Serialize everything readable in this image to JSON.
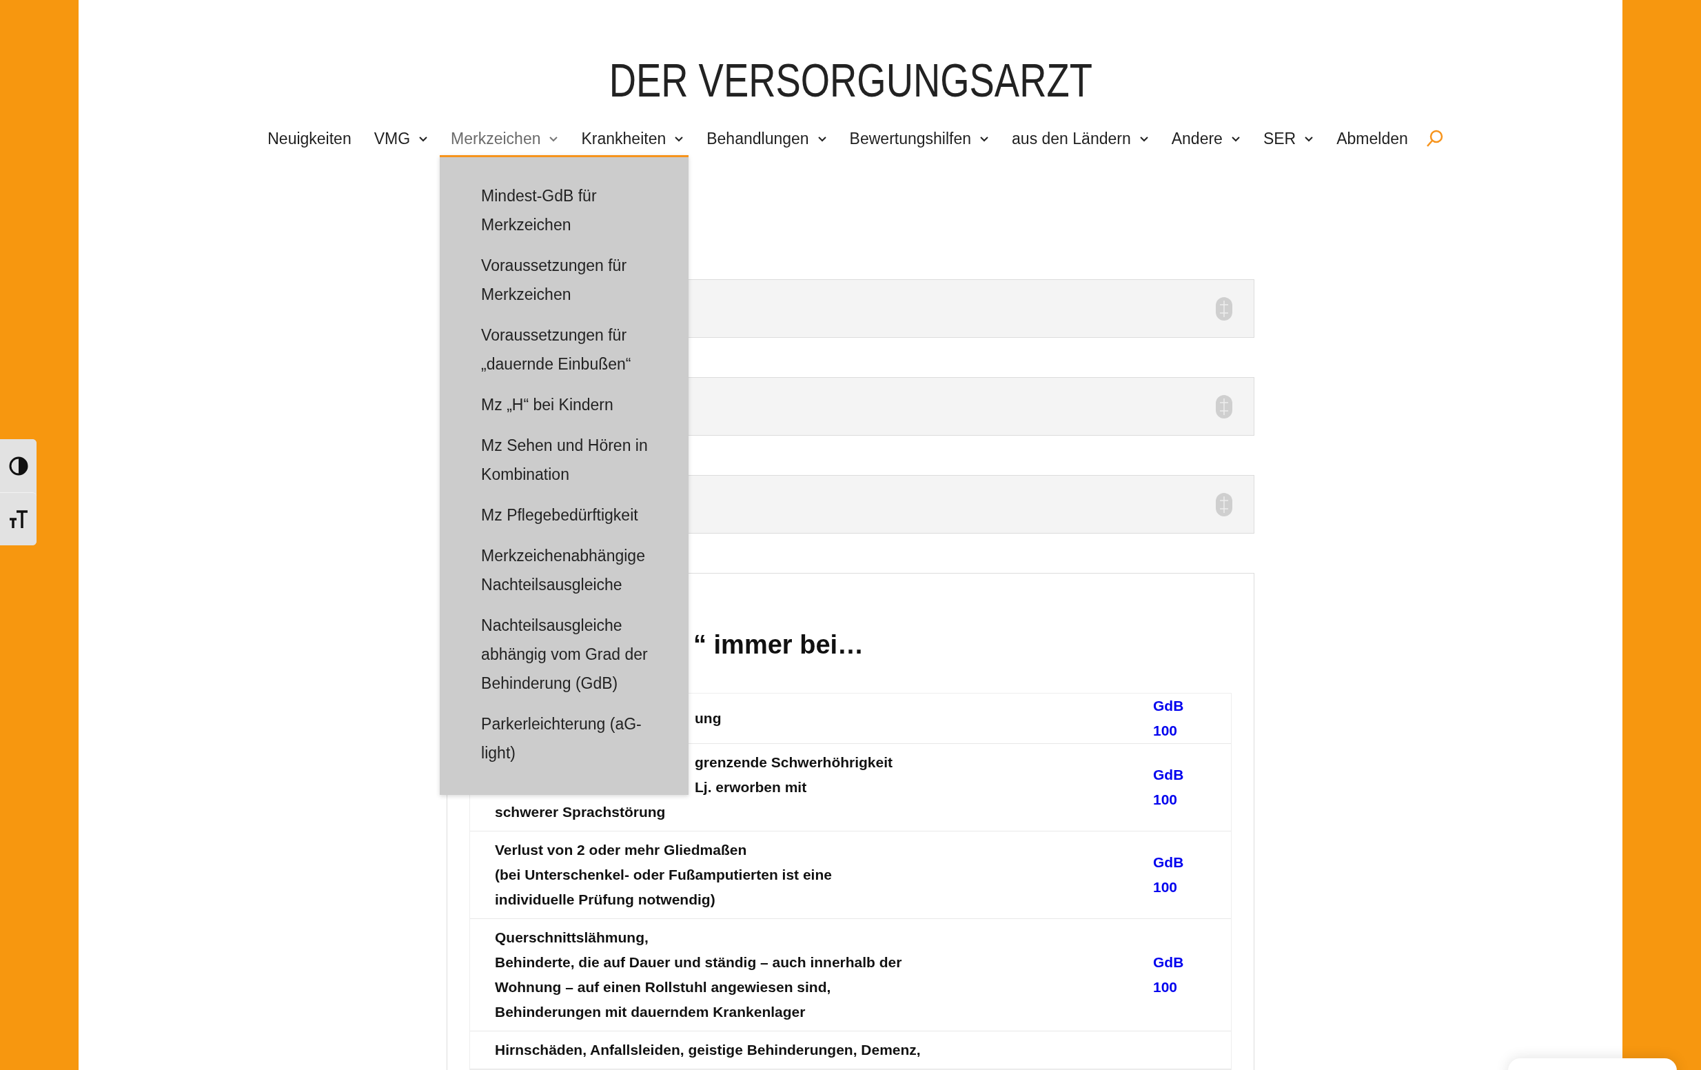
{
  "site": {
    "logo": "DER VERSORGUNGSARZT"
  },
  "nav": [
    {
      "label": "Neuigkeiten",
      "has_menu": false,
      "selected": false
    },
    {
      "label": "VMG",
      "has_menu": true,
      "selected": false
    },
    {
      "label": "Merkzeichen",
      "has_menu": true,
      "selected": true
    },
    {
      "label": "Krankheiten",
      "has_menu": true,
      "selected": false
    },
    {
      "label": "Behandlungen",
      "has_menu": true,
      "selected": false
    },
    {
      "label": "Bewertungshilfen",
      "has_menu": true,
      "selected": false
    },
    {
      "label": "aus den Ländern",
      "has_menu": true,
      "selected": false
    },
    {
      "label": "Andere",
      "has_menu": true,
      "selected": false
    },
    {
      "label": "SER",
      "has_menu": true,
      "selected": false
    },
    {
      "label": "Abmelden",
      "has_menu": false,
      "selected": false
    }
  ],
  "dropdown": {
    "items": [
      "Mindest-GdB für Merkzeichen",
      "Voraussetzungen für Merkzeichen",
      "Voraussetzungen für „dauernde Einbußen“",
      "Mz „H“ bei Kindern",
      "Mz Sehen und Hören in Kombination",
      "Mz Pflegebedürftigkeit",
      "Merkzeichenabhängige Nachteilsausgleiche",
      "Nachteilsausgleiche abhängig vom Grad der Behinderung (GdB)",
      "Parkerleichterung (aG-light)"
    ]
  },
  "accordions": [
    {
      "expanded": false
    },
    {
      "expanded": false
    },
    {
      "expanded": false
    }
  ],
  "section": {
    "heading": {
      "text": "“ immer bei…",
      "covered": true
    },
    "rows": [
      {
        "lines": [
          {
            "text": "ung",
            "covered": true
          }
        ],
        "gdb": "GdB 100"
      },
      {
        "lines": [
          {
            "text": "grenzende Schwerhöhrigkeit",
            "covered": true
          },
          {
            "text": "Lj. erworben mit",
            "covered": true
          },
          {
            "text": "schwerer Sprachstörung"
          }
        ],
        "gdb": "GdB 100"
      },
      {
        "lines": [
          {
            "text": "Verlust von 2 oder mehr Gliedmaßen"
          },
          {
            "text": "(bei Unterschenkel- oder Fußamputierten ist eine"
          },
          {
            "text": "individuelle Prüfung notwendig)"
          }
        ],
        "gdb": "GdB 100"
      },
      {
        "lines": [
          {
            "text": "Querschnittslähmung,"
          },
          {
            "text": "Behinderte, die auf Dauer und ständig – auch innerhalb der"
          },
          {
            "text": "Wohnung – auf einen Rollstuhl angewiesen sind,"
          },
          {
            "text": "Behinderungen mit dauerndem Krankenlager"
          }
        ],
        "gdb": "GdB 100"
      },
      {
        "lines": [
          {
            "text": "Hirnschäden, Anfallsleiden, geistige Behinderungen, Demenz,"
          }
        ]
      }
    ]
  }
}
